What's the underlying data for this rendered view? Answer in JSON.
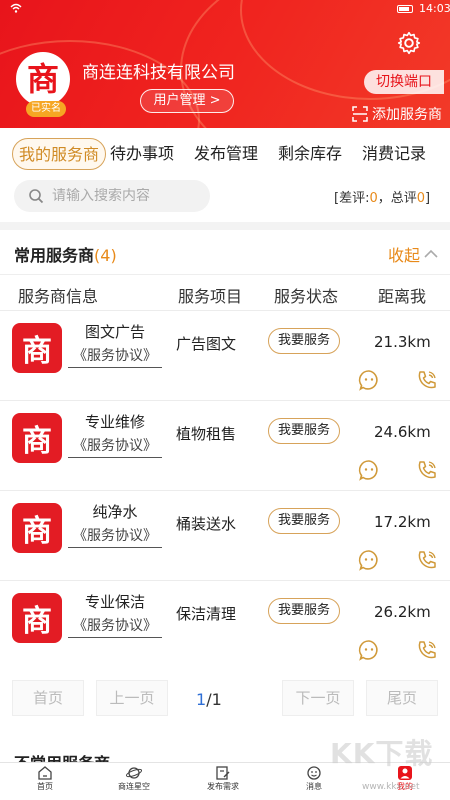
{
  "status_bar": {
    "time": "14:03"
  },
  "header": {
    "company_name": "商连连科技有限公司",
    "avatar_glyph": "商",
    "verified_label": "已实名",
    "user_mgmt_label": "用户管理 >",
    "switch_label": "切换端口",
    "add_provider_label": "添加服务商"
  },
  "tabs": [
    {
      "label": "我的服务商",
      "active": true
    },
    {
      "label": "待办事项"
    },
    {
      "label": "发布管理"
    },
    {
      "label": "剩余库存"
    },
    {
      "label": "消费记录"
    }
  ],
  "search": {
    "placeholder": "请输入搜索内容",
    "rating_prefix": "[差评:",
    "bad_count": "0",
    "rating_mid": "，总评",
    "total_count": "0",
    "rating_suffix": "]"
  },
  "section": {
    "title": "常用服务商",
    "count": "(4)",
    "collapse_label": "收起",
    "columns": [
      "服务商信息",
      "服务项目",
      "服务状态",
      "距离我"
    ]
  },
  "providers": [
    {
      "logo_glyph": "商",
      "name": "图文广告",
      "agreement": "《服务协议》",
      "item": "广告图文",
      "action": "我要服务",
      "distance": "21.3km"
    },
    {
      "logo_glyph": "商",
      "name": "专业维修",
      "agreement": "《服务协议》",
      "item": "植物租售",
      "action": "我要服务",
      "distance": "24.6km"
    },
    {
      "logo_glyph": "商",
      "name": "纯净水",
      "agreement": "《服务协议》",
      "item": "桶装送水",
      "action": "我要服务",
      "distance": "17.2km"
    },
    {
      "logo_glyph": "商",
      "name": "专业保洁",
      "agreement": "《服务协议》",
      "item": "保洁清理",
      "action": "我要服务",
      "distance": "26.2km"
    }
  ],
  "pager": {
    "first": "首页",
    "prev": "上一页",
    "current": "1",
    "total": "/1",
    "next": "下一页",
    "last": "尾页"
  },
  "next_section": {
    "title": "不常用服务商"
  },
  "bottom_nav": [
    {
      "label": "首页",
      "icon": "home-icon"
    },
    {
      "label": "商连星空",
      "icon": "planet-icon"
    },
    {
      "label": "发布需求",
      "icon": "edit-icon"
    },
    {
      "label": "消息",
      "icon": "message-icon"
    },
    {
      "label": "我的",
      "icon": "user-icon",
      "active": true
    }
  ],
  "watermark": {
    "text": "KK下载",
    "url": "www.kkx.net"
  },
  "colors": {
    "brand_red": "#e8141b",
    "accent_orange": "#e88a1a",
    "link_blue": "#2f6fd6"
  }
}
